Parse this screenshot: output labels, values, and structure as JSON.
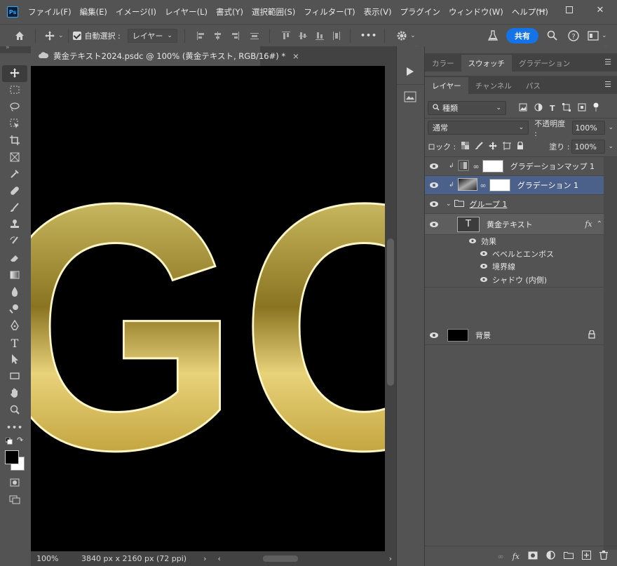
{
  "app": {
    "logo": "Ps"
  },
  "menu": [
    "ファイル(F)",
    "編集(E)",
    "イメージ(I)",
    "レイヤー(L)",
    "書式(Y)",
    "選択範囲(S)",
    "フィルター(T)",
    "表示(V)",
    "プラグイン",
    "ウィンドウ(W)",
    "ヘルプ(H)"
  ],
  "options": {
    "auto_select_label": "自動選択 :",
    "auto_select_value": "レイヤー",
    "share_label": "共有",
    "more": "•••"
  },
  "document": {
    "tab_title": "黄金テキスト2024.psdc @ 100% (黄金テキスト, RGB/16#) *",
    "close": "×",
    "canvas_text": "GO",
    "zoom": "100%",
    "dimensions": "3840 px x 2160 px (72 ppi)"
  },
  "panel_top": {
    "tabs": [
      "カラー",
      "スウォッチ",
      "グラデーション"
    ],
    "active": 1
  },
  "layers_panel": {
    "tabs": [
      "レイヤー",
      "チャンネル",
      "パス"
    ],
    "filter_label": "種類",
    "blend_mode": "通常",
    "opacity_label": "不透明度 :",
    "opacity_value": "100%",
    "lock_label": "ロック :",
    "fill_label": "塗り :",
    "fill_value": "100%",
    "layers": [
      {
        "name": "グラデーションマップ 1",
        "kind": "adjustment"
      },
      {
        "name": "グラデーション 1",
        "kind": "gradient",
        "selected": true
      },
      {
        "name": "グループ 1",
        "kind": "group"
      },
      {
        "name": "黄金テキスト",
        "kind": "text",
        "fx": "fx"
      },
      {
        "name": "背景",
        "kind": "background"
      }
    ],
    "effects_label": "効果",
    "effects": [
      "ベベルとエンボス",
      "境界線",
      "シャドウ (内側)"
    ],
    "text_thumb": "T"
  },
  "colors": {
    "accent": "#1473e6",
    "selected_layer": "#4b6189",
    "bg": "#535353",
    "gold": "#e0cf7a"
  }
}
